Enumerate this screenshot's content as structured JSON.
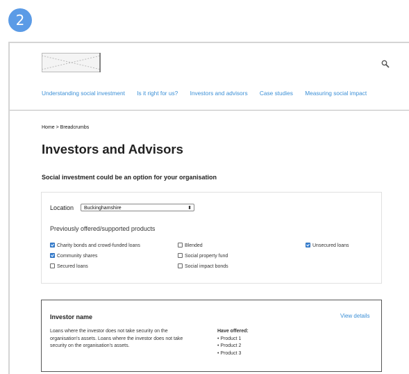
{
  "step_number": "2",
  "header": {
    "nav_items": [
      "Understanding social investment",
      "Is it right for us?",
      "Investors and advisors",
      "Case studies",
      "Measuring social impact"
    ]
  },
  "breadcrumb": "Home > Breadcrumbs",
  "page_title": "Investors and Advisors",
  "subtitle": "Social investment could be an option for your organisation",
  "filters": {
    "location_label": "Location",
    "location_value": "Buckinghamshire",
    "products_heading": "Previously offered/supported products",
    "products": [
      {
        "label": "Charity bonds and crowd-funded loans",
        "checked": true
      },
      {
        "label": "Community shares",
        "checked": true
      },
      {
        "label": "Secured loans",
        "checked": false
      },
      {
        "label": "Blended",
        "checked": false
      },
      {
        "label": "Social property fund",
        "checked": false
      },
      {
        "label": "Social impact bonds",
        "checked": false
      },
      {
        "label": "Unsecured loans",
        "checked": true
      }
    ]
  },
  "investor": {
    "name": "Investor name",
    "view_details": "View details",
    "description": "Loans where the investor does not take security on the organisation's assets. Loans where the investor does not take security on the organisation's assets.",
    "offered_heading": "Have offered:",
    "offered_items": [
      "• Product 1",
      "• Product 2",
      "• Product 3"
    ]
  },
  "colors": {
    "accent": "#3b8fd6",
    "badge": "#5b9be6",
    "checkbox_on": "#3d86d8"
  }
}
